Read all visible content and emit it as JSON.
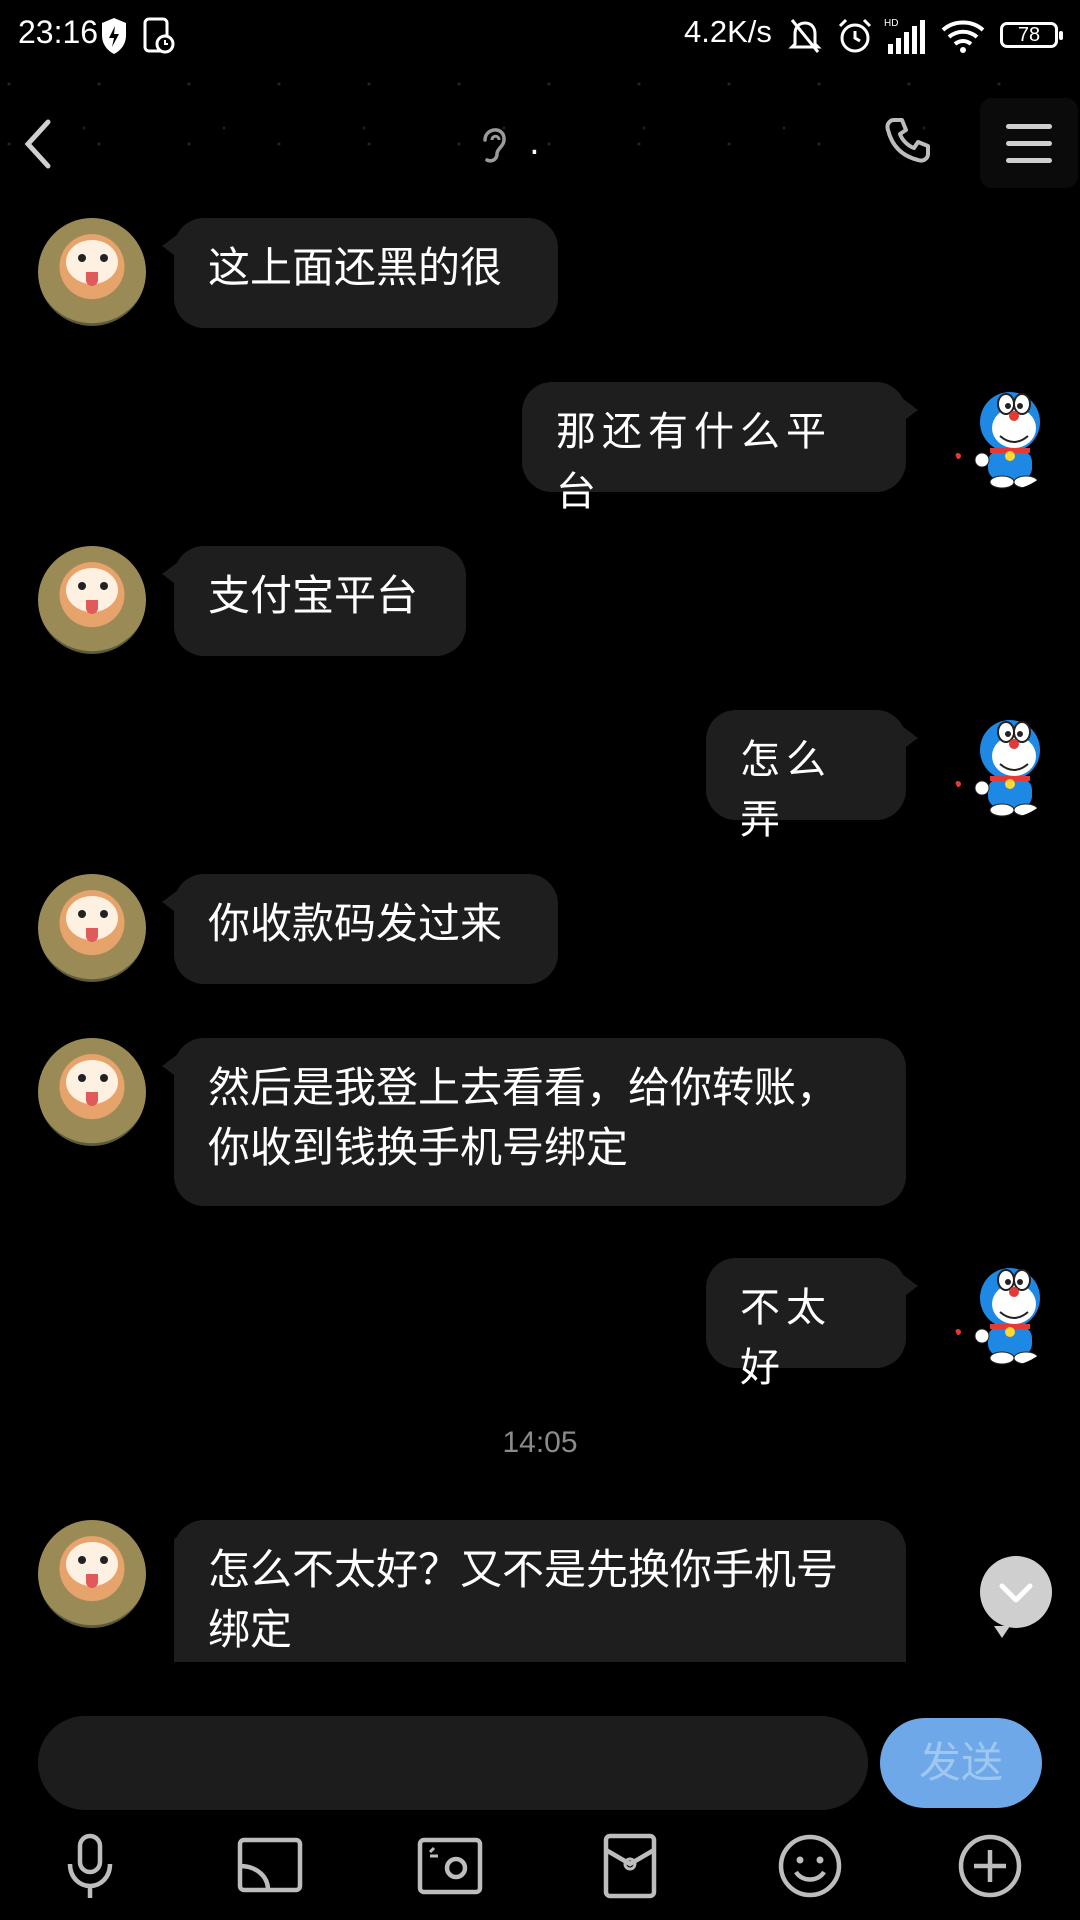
{
  "status_bar": {
    "time": "23:16",
    "speed": "4.2K/s",
    "battery": "78"
  },
  "header": {
    "title": "."
  },
  "messages": [
    {
      "side": "left",
      "text": "这上面还黑的很"
    },
    {
      "side": "right",
      "text": "那还有什么平台"
    },
    {
      "side": "left",
      "text": "支付宝平台"
    },
    {
      "side": "right",
      "text": "怎么弄"
    },
    {
      "side": "left",
      "text": "你收款码发过来"
    },
    {
      "side": "left",
      "text": "然后是我登上去看看，给你转账，你收到钱换手机号绑定"
    },
    {
      "side": "right",
      "text": "不太好"
    },
    {
      "side": "left",
      "text": "怎么不太好？又不是先换你手机号绑定"
    }
  ],
  "timestamp": "14:05",
  "composer": {
    "placeholder": "",
    "send_label": "发送"
  },
  "toolbar_icons": [
    "microphone-icon",
    "image-cast-icon",
    "camera-icon",
    "red-envelope-icon",
    "emoji-icon",
    "plus-icon"
  ],
  "colors": {
    "background": "#000000",
    "bubble": "#1e1e1e",
    "send_button": "#6fa8e8"
  }
}
